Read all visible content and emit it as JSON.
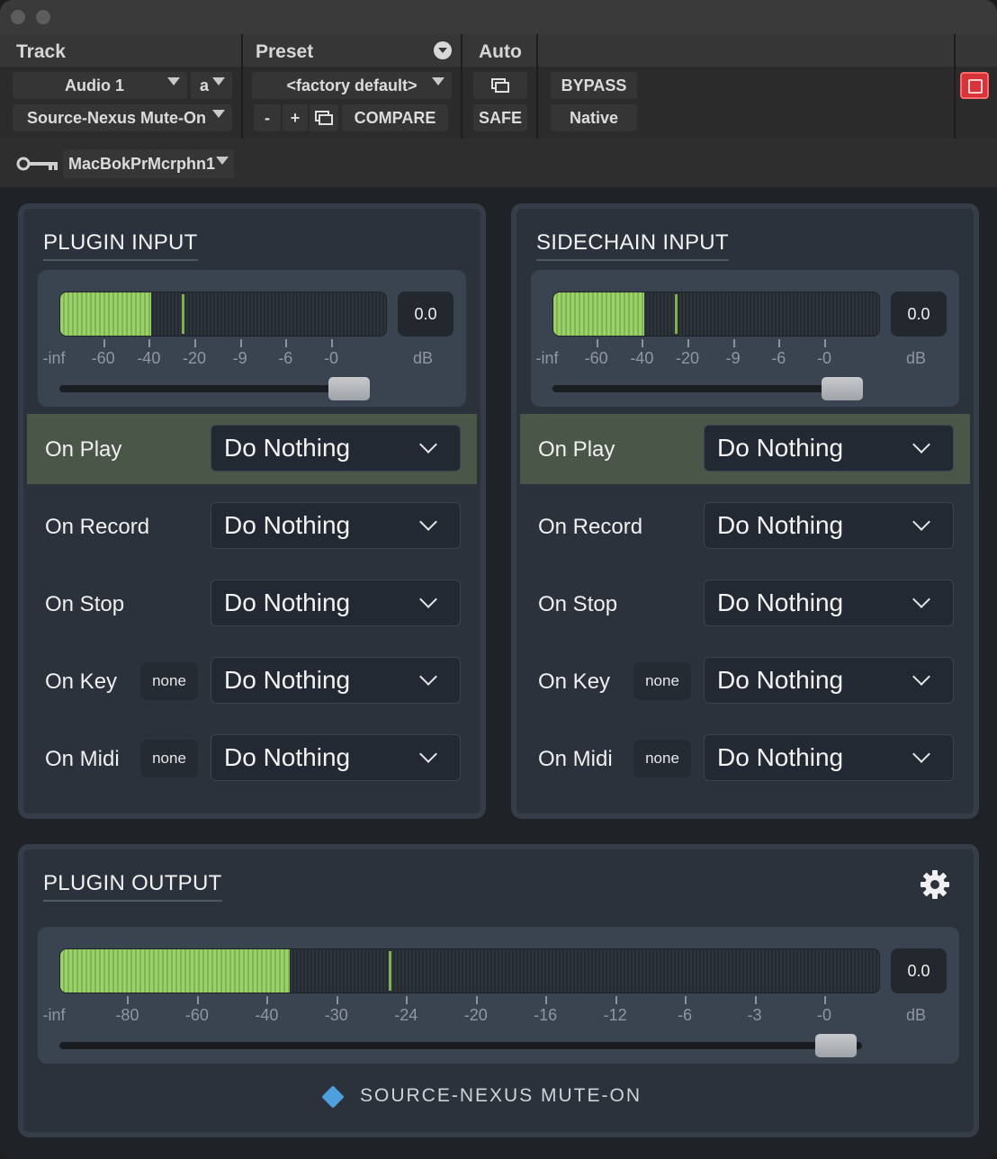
{
  "host": {
    "track_header": "Track",
    "preset_header": "Preset",
    "auto_header": "Auto",
    "track_name": "Audio 1",
    "track_variant": "a",
    "plugin_name": "Source-Nexus Mute-On",
    "preset_name": "<factory default>",
    "minus": "-",
    "plus": "+",
    "compare": "COMPARE",
    "safe": "SAFE",
    "bypass": "BYPASS",
    "native": "Native",
    "sidechain_source": "MacBokPrMcrphn1"
  },
  "colors": {
    "meter_green": "#9cd06a",
    "active_row": "#4a5647",
    "panel": "#2b323c",
    "bypass_red": "#d6333a",
    "brand_blue": "#4f9fdc"
  },
  "plugin_input": {
    "title": "PLUGIN INPUT",
    "meter_value": "0.0",
    "meter_level": 0.28,
    "peak_level": 0.37,
    "slider_level": 0.94,
    "scale": [
      "-inf",
      "-60",
      "-40",
      "-20",
      "-9",
      "-6",
      "-0",
      "dB"
    ],
    "rows": [
      {
        "label": "On Play",
        "action": "Do Nothing",
        "active": true
      },
      {
        "label": "On Record",
        "action": "Do Nothing"
      },
      {
        "label": "On Stop",
        "action": "Do Nothing"
      },
      {
        "label": "On Key",
        "chip": "none",
        "action": "Do Nothing"
      },
      {
        "label": "On Midi",
        "chip": "none",
        "action": "Do Nothing"
      }
    ]
  },
  "sidechain_input": {
    "title": "SIDECHAIN INPUT",
    "meter_value": "0.0",
    "meter_level": 0.28,
    "peak_level": 0.37,
    "slider_level": 0.94,
    "scale": [
      "-inf",
      "-60",
      "-40",
      "-20",
      "-9",
      "-6",
      "-0",
      "dB"
    ],
    "rows": [
      {
        "label": "On Play",
        "action": "Do Nothing",
        "active": true
      },
      {
        "label": "On Record",
        "action": "Do Nothing"
      },
      {
        "label": "On Stop",
        "action": "Do Nothing"
      },
      {
        "label": "On Key",
        "chip": "none",
        "action": "Do Nothing"
      },
      {
        "label": "On Midi",
        "chip": "none",
        "action": "Do Nothing"
      }
    ]
  },
  "plugin_output": {
    "title": "PLUGIN OUTPUT",
    "meter_value": "0.0",
    "meter_level": 0.28,
    "peak_level": 0.4,
    "slider_level": 0.97,
    "scale": [
      "-inf",
      "-80",
      "-60",
      "-40",
      "-30",
      "-24",
      "-20",
      "-16",
      "-12",
      "-6",
      "-3",
      "-0",
      "dB"
    ]
  },
  "footer": {
    "brand": "SOURCE-NEXUS MUTE-ON"
  }
}
